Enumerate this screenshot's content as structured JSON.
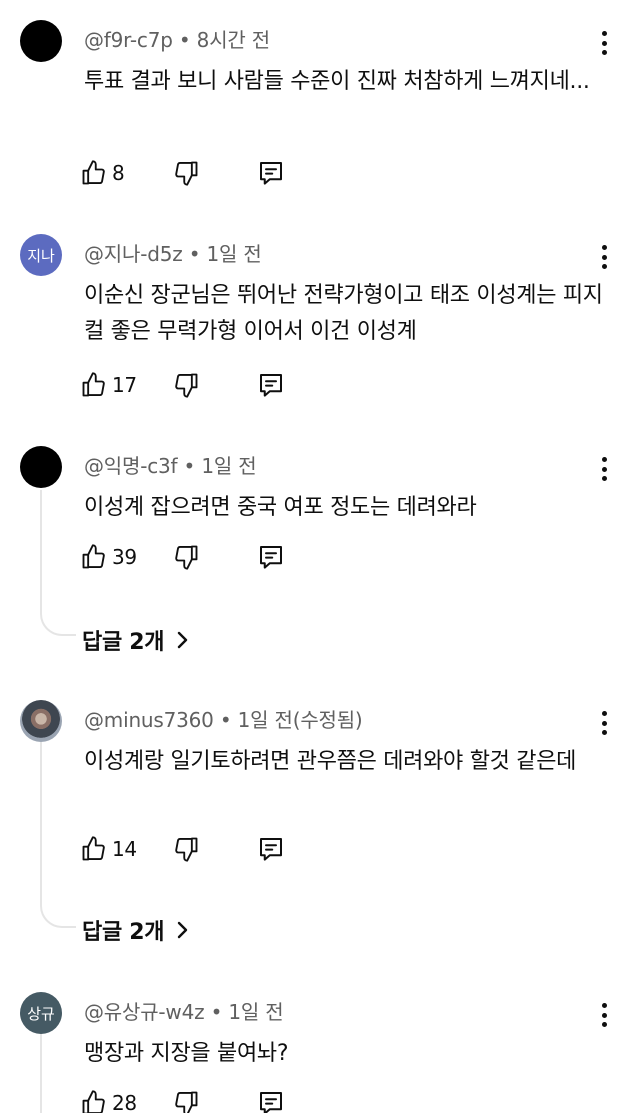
{
  "comments": [
    {
      "handle": "@f9r-c7p",
      "time": "8시간 전",
      "text": "투표 결과 보니 사람들 수준이 진짜 처참하게 느껴지네...",
      "likes": "8",
      "avatar_label": ""
    },
    {
      "handle": "@지나-d5z",
      "time": "1일 전",
      "text": "이순신 장군님은 뛰어난 전략가형이고 태조 이성계는 피지컬 좋은 무력가형 이어서 이건 이성계",
      "likes": "17",
      "avatar_label": "지나"
    },
    {
      "handle": "@익명-c3f",
      "time": "1일 전",
      "text": "이성계 잡으려면 중국 여포 정도는 데려와라",
      "likes": "39",
      "avatar_label": "",
      "replies": "답글 2개"
    },
    {
      "handle": "@minus7360",
      "time": "1일 전(수정됨)",
      "text": "이성계랑 일기토하려면 관우쯤은 데려와야 할것 같은데",
      "likes": "14",
      "avatar_label": "",
      "replies": "답글 2개"
    },
    {
      "handle": "@유상규-w4z",
      "time": "1일 전",
      "text": "맹장과 지장을 붙여놔?",
      "likes": "28",
      "avatar_label": "상규"
    }
  ],
  "separator": " • ",
  "icons": {
    "like": "thumbs-up-icon",
    "dislike": "thumbs-down-icon",
    "reply": "reply-comment-icon",
    "more": "more-vertical-icon",
    "chevron": "chevron-right-icon"
  },
  "colors": {
    "text": "#0f0f0f",
    "meta": "#606060",
    "thread": "#e5e5e5",
    "avatar_jina": "#5c6bc0",
    "avatar_sanggyu": "#455a64"
  }
}
